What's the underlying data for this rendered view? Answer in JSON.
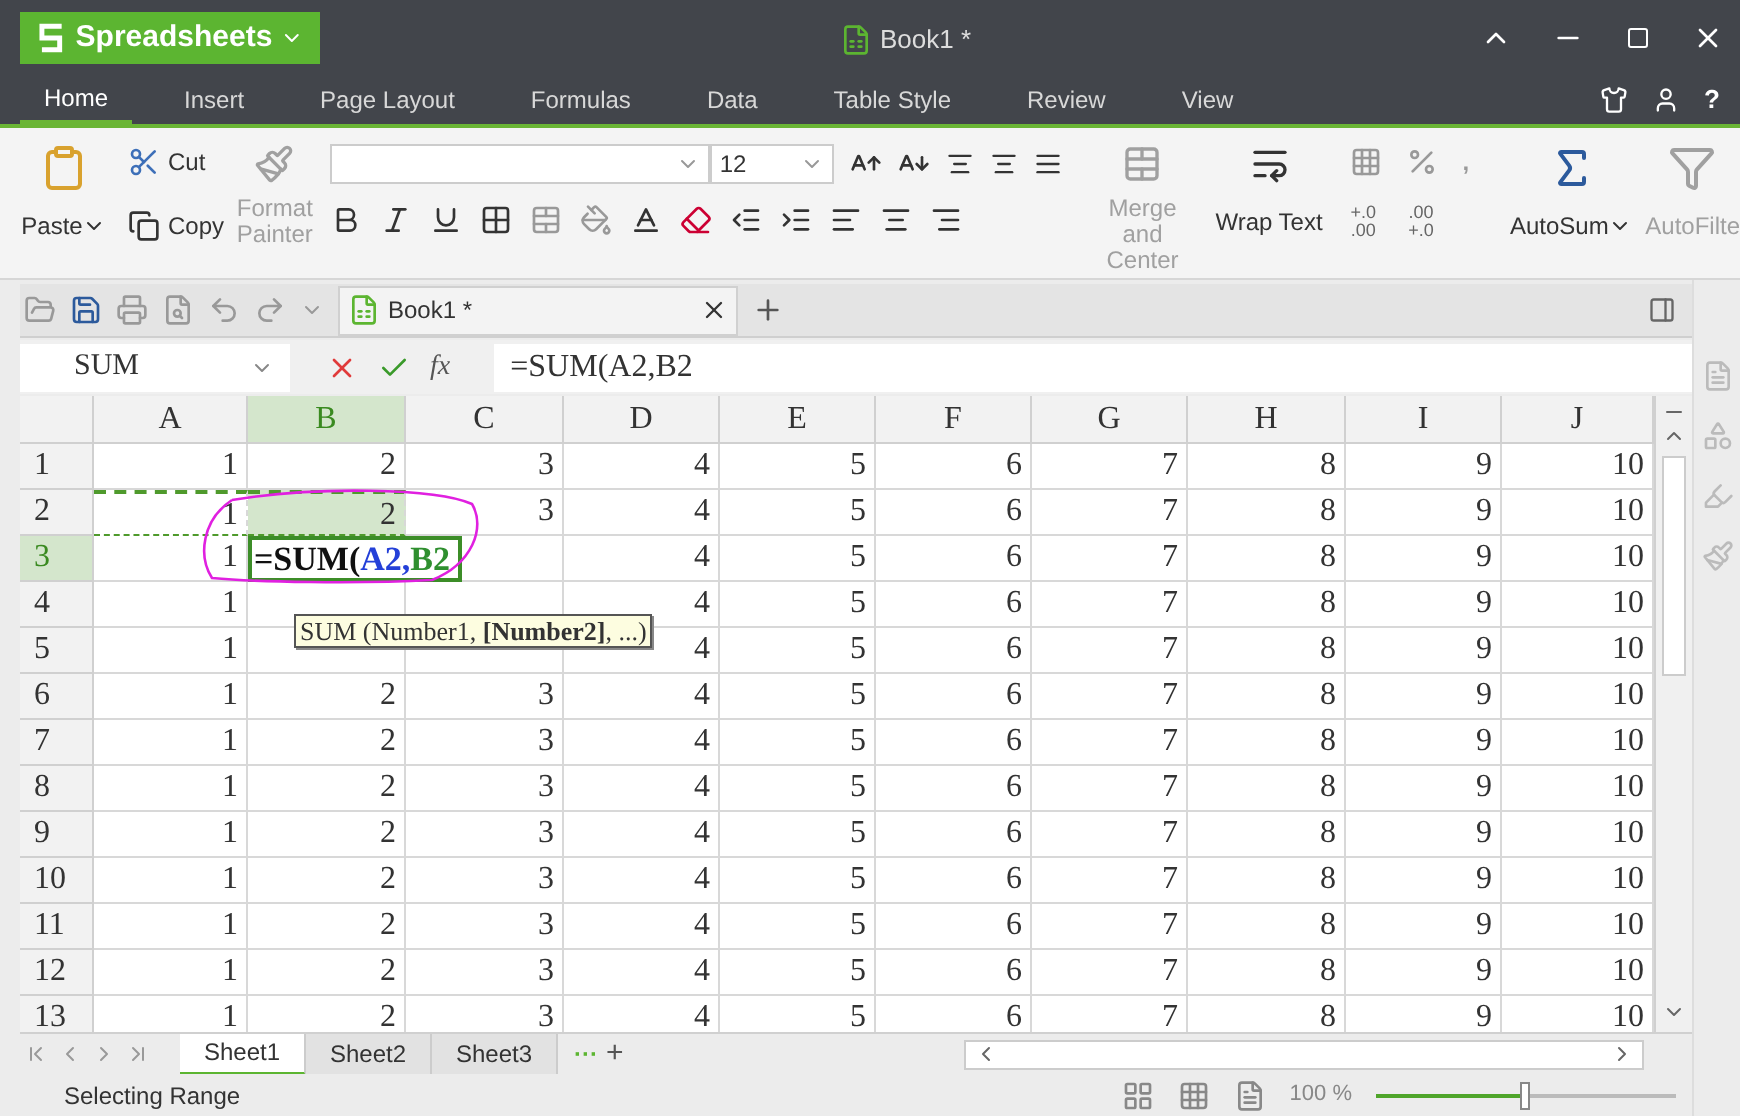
{
  "app_menu": {
    "label": "Spreadsheets"
  },
  "title": "Book1 *",
  "menu_tabs": [
    {
      "label": "Home",
      "selected": true
    },
    {
      "label": "Insert",
      "selected": false
    },
    {
      "label": "Page Layout",
      "selected": false
    },
    {
      "label": "Formulas",
      "selected": false
    },
    {
      "label": "Data",
      "selected": false
    },
    {
      "label": "Table Style",
      "selected": false
    },
    {
      "label": "Review",
      "selected": false
    },
    {
      "label": "View",
      "selected": false
    }
  ],
  "help": "?",
  "ribbon": {
    "paste": "Paste",
    "cut": "Cut",
    "copy": "Copy",
    "format_painter": {
      "label": "Format Painter",
      "disabled": true
    },
    "font_size": "12",
    "merge": {
      "label": "Merge and Center",
      "disabled": true
    },
    "wrap": {
      "label": "Wrap Text",
      "disabled": false
    },
    "decimals": [
      {
        "top": "+.0",
        "bottom": ".00"
      },
      {
        "top": ".00",
        "bottom": "+.0"
      }
    ],
    "comma": ",",
    "autosum": {
      "label": "AutoSum",
      "disabled": false
    },
    "autofilter": {
      "label": "AutoFilte",
      "disabled": true
    }
  },
  "document_tab": {
    "label": "Book1 *"
  },
  "name_box": "SUM",
  "fx": "fx",
  "formula": "=SUM(A2,B2",
  "columns": [
    {
      "label": "A",
      "selected": false
    },
    {
      "label": "B",
      "selected": true
    },
    {
      "label": "C",
      "selected": false
    },
    {
      "label": "D",
      "selected": false
    },
    {
      "label": "E",
      "selected": false
    },
    {
      "label": "F",
      "selected": false
    },
    {
      "label": "G",
      "selected": false
    },
    {
      "label": "H",
      "selected": false
    },
    {
      "label": "I",
      "selected": false
    },
    {
      "label": "J",
      "selected": false
    }
  ],
  "rows": [
    {
      "label": "1",
      "selected": false,
      "cells": [
        "1",
        "2",
        "3",
        "4",
        "5",
        "6",
        "7",
        "8",
        "9",
        "10"
      ]
    },
    {
      "label": "2",
      "selected": false,
      "cells": [
        {
          "kind": "range",
          "text": "1",
          "selected": false
        },
        {
          "kind": "range",
          "text": "2",
          "selected": true
        },
        "3",
        "4",
        "5",
        "6",
        "7",
        "8",
        "9",
        "10"
      ]
    },
    {
      "label": "3",
      "selected": true,
      "cells": [
        "1",
        {
          "kind": "editing",
          "segments": [
            {
              "text": "=SUM(",
              "color": "#111111"
            },
            {
              "text": "A2",
              "color": "#2440d8"
            },
            {
              "text": ",",
              "color": "#2440d8"
            },
            {
              "text": "B2",
              "color": "#2f8f2f"
            }
          ]
        },
        {
          "kind": "blank"
        },
        "4",
        "5",
        "6",
        "7",
        "8",
        "9",
        "10"
      ]
    },
    {
      "label": "4",
      "selected": false,
      "cells": [
        "1",
        {
          "kind": "blank"
        },
        {
          "kind": "blank"
        },
        "4",
        "5",
        "6",
        "7",
        "8",
        "9",
        "10"
      ]
    },
    {
      "label": "5",
      "selected": false,
      "cells": [
        "1",
        {
          "kind": "blank"
        },
        {
          "kind": "blank"
        },
        "4",
        "5",
        "6",
        "7",
        "8",
        "9",
        "10"
      ]
    },
    {
      "label": "6",
      "selected": false,
      "cells": [
        "1",
        "2",
        "3",
        "4",
        "5",
        "6",
        "7",
        "8",
        "9",
        "10"
      ]
    },
    {
      "label": "7",
      "selected": false,
      "cells": [
        "1",
        "2",
        "3",
        "4",
        "5",
        "6",
        "7",
        "8",
        "9",
        "10"
      ]
    },
    {
      "label": "8",
      "selected": false,
      "cells": [
        "1",
        "2",
        "3",
        "4",
        "5",
        "6",
        "7",
        "8",
        "9",
        "10"
      ]
    },
    {
      "label": "9",
      "selected": false,
      "cells": [
        "1",
        "2",
        "3",
        "4",
        "5",
        "6",
        "7",
        "8",
        "9",
        "10"
      ]
    },
    {
      "label": "10",
      "selected": false,
      "cells": [
        "1",
        "2",
        "3",
        "4",
        "5",
        "6",
        "7",
        "8",
        "9",
        "10"
      ]
    },
    {
      "label": "11",
      "selected": false,
      "cells": [
        "1",
        "2",
        "3",
        "4",
        "5",
        "6",
        "7",
        "8",
        "9",
        "10"
      ]
    },
    {
      "label": "12",
      "selected": false,
      "cells": [
        "1",
        "2",
        "3",
        "4",
        "5",
        "6",
        "7",
        "8",
        "9",
        "10"
      ]
    },
    {
      "label": "13",
      "selected": false,
      "cells": [
        "1",
        "2",
        "3",
        "4",
        "5",
        "6",
        "7",
        "8",
        "9",
        "10"
      ]
    }
  ],
  "tooltip": "SUM (Number1, **[Number2]**, ...)",
  "sheets": [
    {
      "label": "Sheet1",
      "selected": true
    },
    {
      "label": "Sheet2",
      "selected": false
    },
    {
      "label": "Sheet3",
      "selected": false
    }
  ],
  "more_sheets": "···",
  "add_sheet": "+",
  "status": "Selecting Range",
  "zoom": {
    "reading": "100 %",
    "level": 0.5
  }
}
